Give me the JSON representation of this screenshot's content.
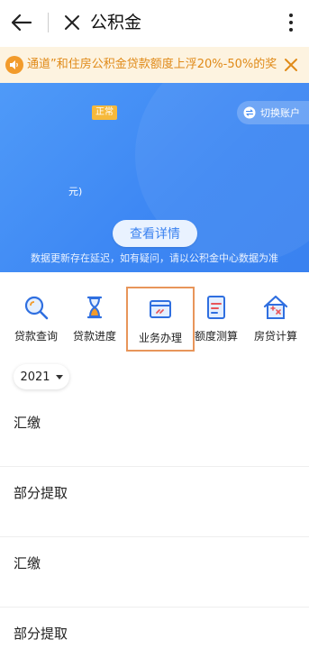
{
  "header": {
    "title": "公积金"
  },
  "notice": {
    "text": "通道”和住房公积金贷款额度上浮20%-50%的奖"
  },
  "account_card": {
    "status_badge": "正常",
    "switch_label": "切换账户",
    "unit_suffix": "元)",
    "detail_button": "查看详情",
    "tip": "数据更新存在延迟，如有疑问，请以公积金中心数据为准"
  },
  "services": [
    {
      "label": "贷款查询",
      "icon": "search-icon"
    },
    {
      "label": "贷款进度",
      "icon": "hourglass-icon"
    },
    {
      "label": "业务办理",
      "icon": "card-icon"
    },
    {
      "label": "额度测算",
      "icon": "document-icon"
    },
    {
      "label": "房贷计算",
      "icon": "house-calc-icon"
    }
  ],
  "year_selector": {
    "value": "2021"
  },
  "records": [
    {
      "name": "汇缴"
    },
    {
      "name": "部分提取"
    },
    {
      "name": "汇缴"
    },
    {
      "name": "部分提取"
    }
  ],
  "colors": {
    "primary_blue": "#3c86f3",
    "notice_bg": "#fdf3e0",
    "notice_text": "#e08a18",
    "status_badge": "#f6b93b",
    "highlight_border": "#e8955a"
  }
}
